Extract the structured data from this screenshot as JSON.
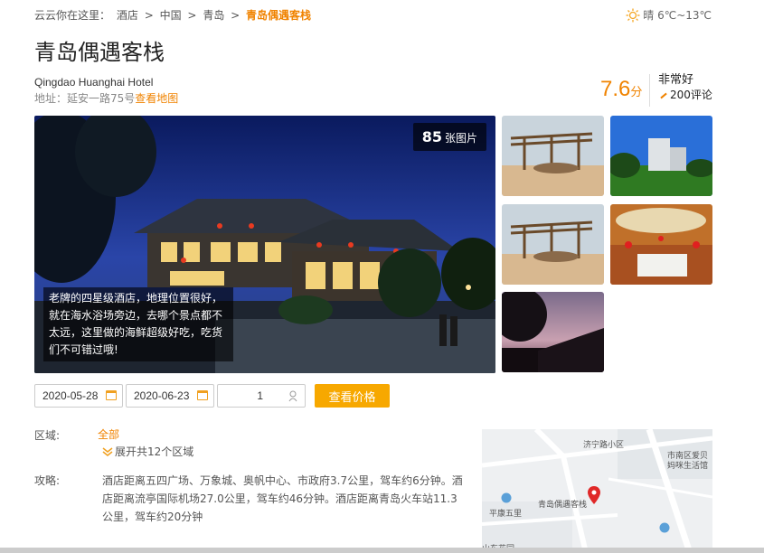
{
  "breadcrumb": {
    "prefix": "云云你在这里：",
    "items": [
      "酒店",
      "中国",
      "青岛"
    ],
    "separator": ">",
    "current": "青岛偶遇客栈"
  },
  "weather": {
    "text": "晴 6℃~13℃",
    "icon": "sun-icon"
  },
  "hotel": {
    "name": "青岛偶遇客栈",
    "name_en": "Qingdao Huanghai Hotel",
    "address_label": "地址：延安一路75号",
    "map_link": "查看地图"
  },
  "rating": {
    "score": "7.6",
    "unit": "分",
    "label": "非常好",
    "reviews": "200评论"
  },
  "gallery": {
    "count": "85",
    "count_suffix": "张图片",
    "caption": "老牌的四星级酒店，地理位置很好，就在海水浴场旁边，去哪个景点都不太远，这里做的海鲜超级好吃，吃货们不可错过哦!"
  },
  "booking": {
    "checkin": "2020-05-28",
    "checkout": "2020-06-23",
    "guests": "1",
    "search_label": "查看价格"
  },
  "region": {
    "label": "区域:",
    "all": "全部",
    "expand": "展开共12个区域"
  },
  "guide": {
    "label": "攻略:",
    "text": "酒店距离五四广场、万象城、奥帆中心、市政府3.7公里，驾车约6分钟。酒店距离流亭国际机场27.0公里，驾车约46分钟。酒店距离青岛火车站11.3公里，驾车约20分钟"
  },
  "map": {
    "labels": [
      "济宁路小区",
      "市南区爱贝",
      "妈咪生活馆",
      "平康五里",
      "青岛偶遇客栈",
      "山东花园"
    ]
  },
  "colors": {
    "accent": "#f08300",
    "button": "#f7a800"
  }
}
